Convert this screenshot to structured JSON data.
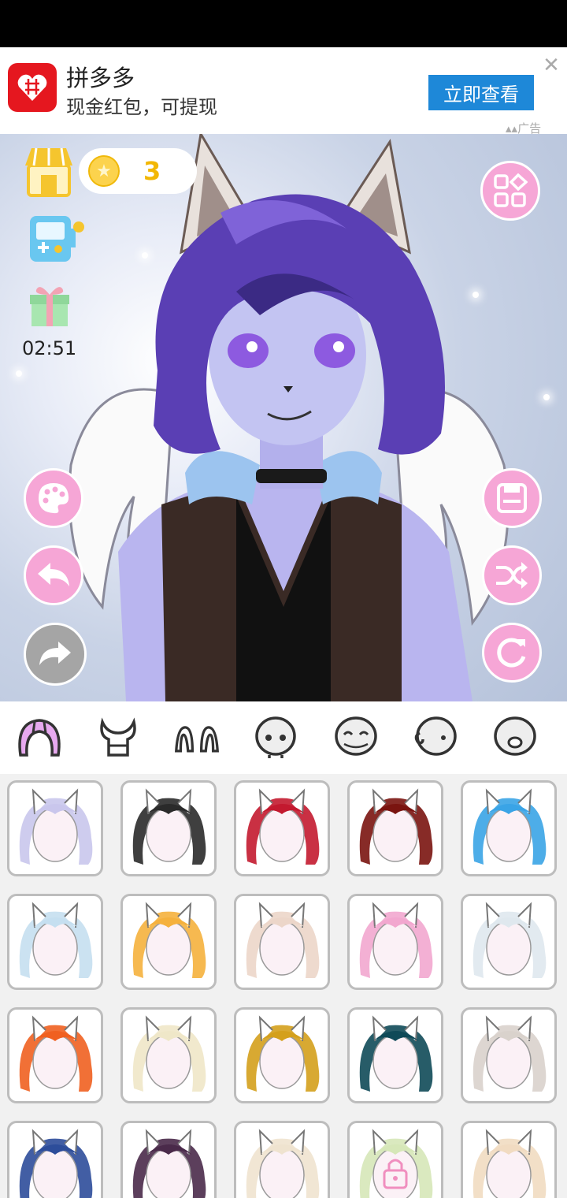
{
  "ad": {
    "title": "拼多多",
    "subtitle": "现金红包，可提现",
    "button": "立即查看",
    "close": "✕",
    "tag": "广告"
  },
  "hud": {
    "coins": "3",
    "timer": "02:51"
  },
  "icons": {
    "shop": "shop-icon",
    "game": "game-machine-icon",
    "gift": "gift-icon",
    "menu": "grid-menu-icon",
    "palette": "palette-icon",
    "undo": "undo-icon",
    "redo": "redo-icon",
    "save": "save-icon",
    "shuffle": "shuffle-icon",
    "reset": "reset-icon"
  },
  "tabs": [
    {
      "name": "hair",
      "icon": "hair-icon",
      "selected": true
    },
    {
      "name": "horns",
      "icon": "horns-icon"
    },
    {
      "name": "ears",
      "icon": "ears-icon"
    },
    {
      "name": "face",
      "icon": "face-icon"
    },
    {
      "name": "eyes",
      "icon": "eyes-icon"
    },
    {
      "name": "ear-face",
      "icon": "ear-face-icon"
    },
    {
      "name": "mouth",
      "icon": "mouth-icon"
    }
  ],
  "hair_options": [
    {
      "color": "#c9c6ec"
    },
    {
      "color": "#2a2a2a"
    },
    {
      "color": "#c3192f"
    },
    {
      "color": "#7a1410"
    },
    {
      "color": "#3aa4e6"
    },
    {
      "color": "#c5dff0"
    },
    {
      "color": "#f5b13d"
    },
    {
      "color": "#ecd6c9"
    },
    {
      "color": "#f2a7cf"
    },
    {
      "color": "#dfe8ee"
    },
    {
      "color": "#f06020"
    },
    {
      "color": "#efe7c8"
    },
    {
      "color": "#d4a01c"
    },
    {
      "color": "#0f4a58"
    },
    {
      "color": "#d9d2cc"
    },
    {
      "color": "#2d4d9a"
    },
    {
      "color": "#4a2a4a"
    },
    {
      "color": "#efe3cf"
    },
    {
      "color": "#d6e7b8",
      "locked": true
    },
    {
      "color": "#f1dbc1"
    }
  ],
  "colors": {
    "accent_pink": "#f6a6d6",
    "ad_red": "#e5171f",
    "ad_blue": "#1e88d8",
    "coin_gold": "#f2b705"
  }
}
